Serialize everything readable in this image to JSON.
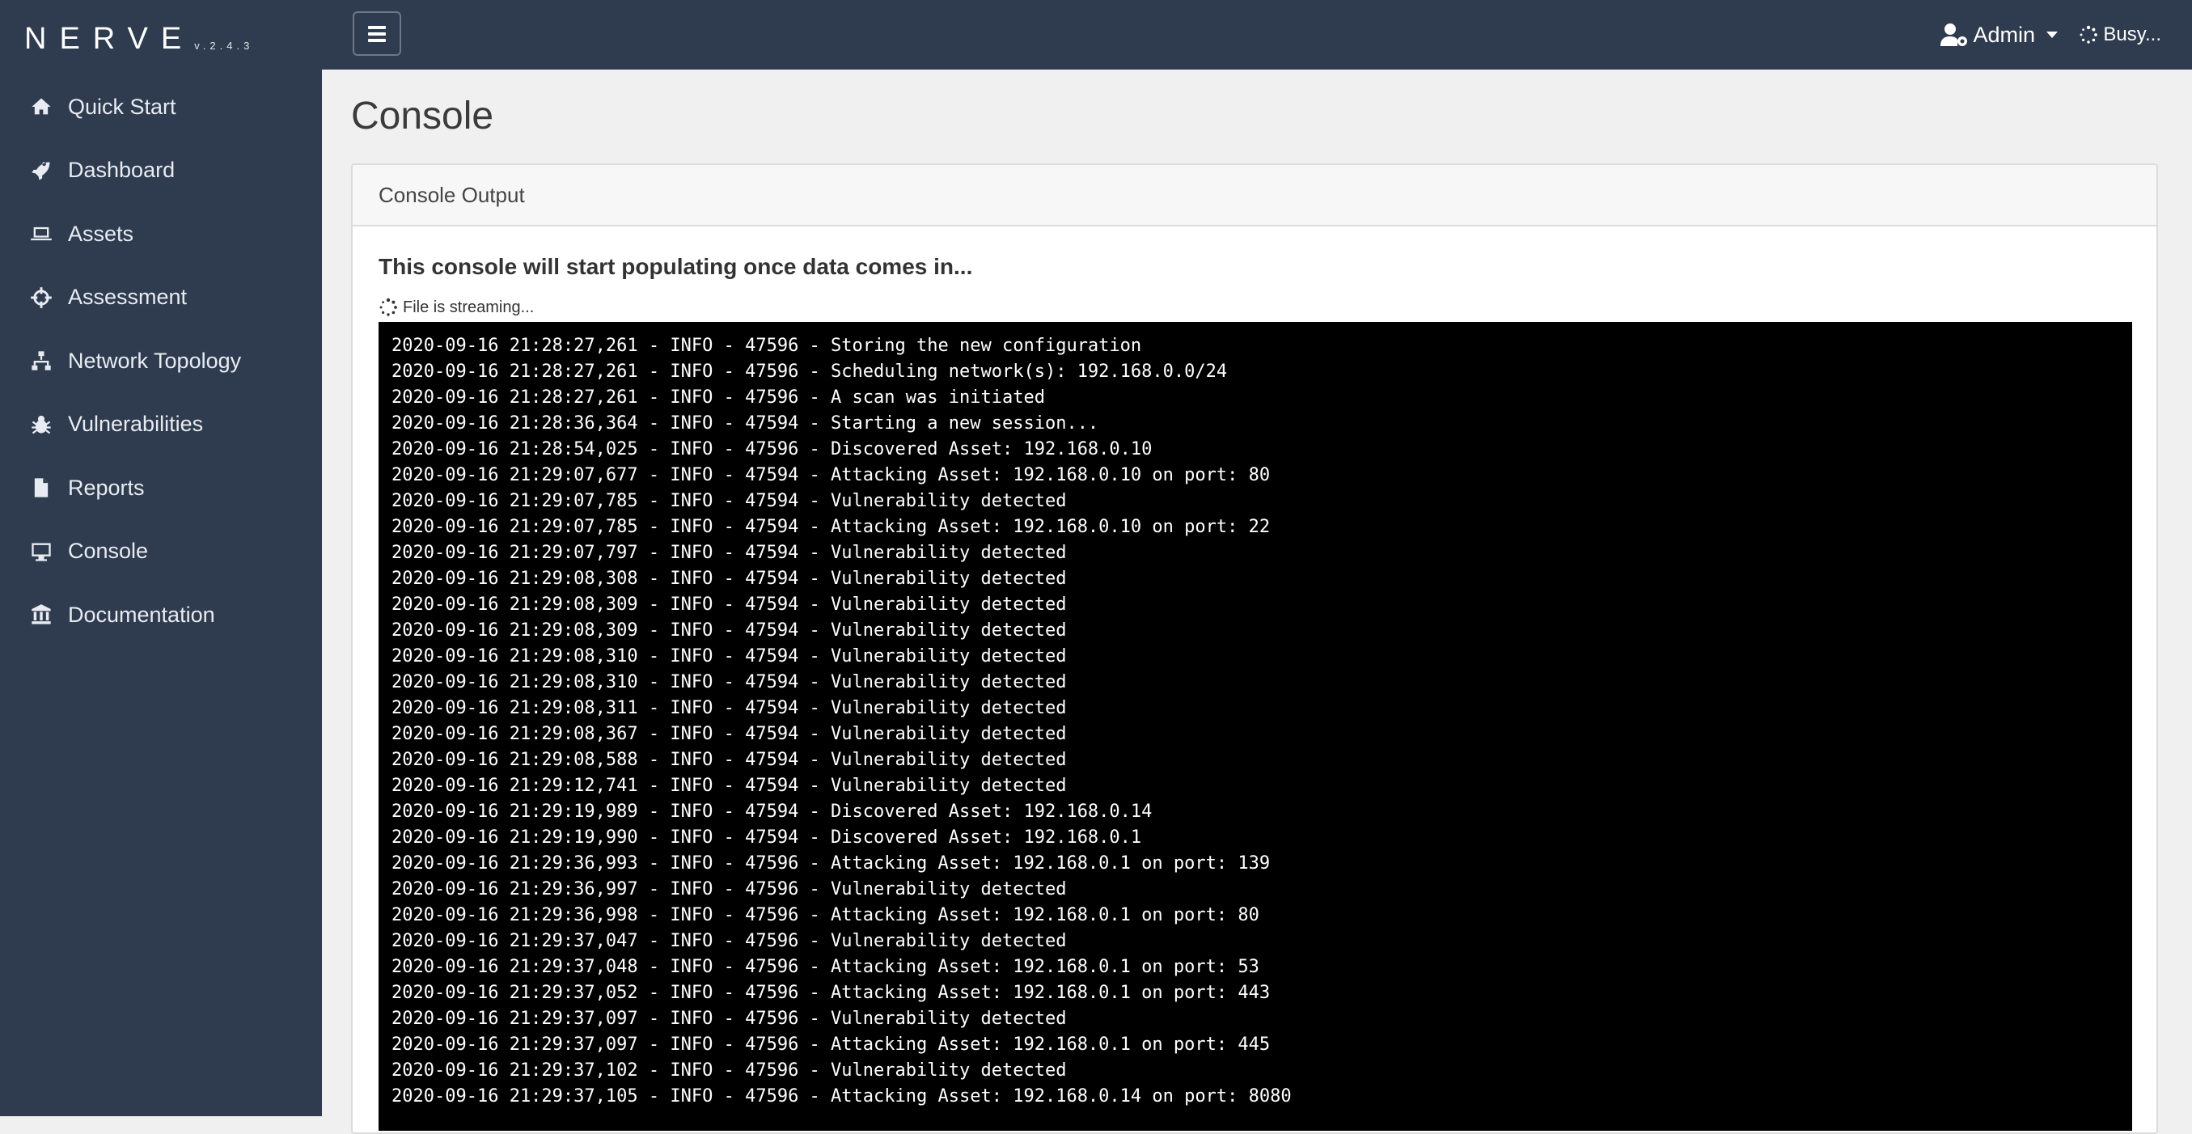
{
  "brand": {
    "name": "NERVE",
    "version": "v.2.4.3"
  },
  "sidebar": {
    "items": [
      {
        "label": "Quick Start",
        "icon": "home-icon"
      },
      {
        "label": "Dashboard",
        "icon": "rocket-icon"
      },
      {
        "label": "Assets",
        "icon": "laptop-icon"
      },
      {
        "label": "Assessment",
        "icon": "crosshairs-icon"
      },
      {
        "label": "Network Topology",
        "icon": "sitemap-icon"
      },
      {
        "label": "Vulnerabilities",
        "icon": "bug-icon"
      },
      {
        "label": "Reports",
        "icon": "file-icon"
      },
      {
        "label": "Console",
        "icon": "desktop-icon"
      },
      {
        "label": "Documentation",
        "icon": "university-icon"
      }
    ]
  },
  "topbar": {
    "user_label": "Admin",
    "status_label": "Busy..."
  },
  "main": {
    "title": "Console",
    "card_header": "Console Output",
    "lead": "This console will start populating once data comes in...",
    "streaming_label": "File is streaming...",
    "log_lines": [
      "2020-09-16 21:28:27,261 - INFO - 47596 - Storing the new configuration",
      "2020-09-16 21:28:27,261 - INFO - 47596 - Scheduling network(s): 192.168.0.0/24",
      "2020-09-16 21:28:27,261 - INFO - 47596 - A scan was initiated",
      "2020-09-16 21:28:36,364 - INFO - 47594 - Starting a new session...",
      "2020-09-16 21:28:54,025 - INFO - 47596 - Discovered Asset: 192.168.0.10",
      "2020-09-16 21:29:07,677 - INFO - 47594 - Attacking Asset: 192.168.0.10 on port: 80",
      "2020-09-16 21:29:07,785 - INFO - 47594 - Vulnerability detected",
      "2020-09-16 21:29:07,785 - INFO - 47594 - Attacking Asset: 192.168.0.10 on port: 22",
      "2020-09-16 21:29:07,797 - INFO - 47594 - Vulnerability detected",
      "2020-09-16 21:29:08,308 - INFO - 47594 - Vulnerability detected",
      "2020-09-16 21:29:08,309 - INFO - 47594 - Vulnerability detected",
      "2020-09-16 21:29:08,309 - INFO - 47594 - Vulnerability detected",
      "2020-09-16 21:29:08,310 - INFO - 47594 - Vulnerability detected",
      "2020-09-16 21:29:08,310 - INFO - 47594 - Vulnerability detected",
      "2020-09-16 21:29:08,311 - INFO - 47594 - Vulnerability detected",
      "2020-09-16 21:29:08,367 - INFO - 47594 - Vulnerability detected",
      "2020-09-16 21:29:08,588 - INFO - 47594 - Vulnerability detected",
      "2020-09-16 21:29:12,741 - INFO - 47594 - Vulnerability detected",
      "2020-09-16 21:29:19,989 - INFO - 47594 - Discovered Asset: 192.168.0.14",
      "2020-09-16 21:29:19,990 - INFO - 47594 - Discovered Asset: 192.168.0.1",
      "2020-09-16 21:29:36,993 - INFO - 47596 - Attacking Asset: 192.168.0.1 on port: 139",
      "2020-09-16 21:29:36,997 - INFO - 47596 - Vulnerability detected",
      "2020-09-16 21:29:36,998 - INFO - 47596 - Attacking Asset: 192.168.0.1 on port: 80",
      "2020-09-16 21:29:37,047 - INFO - 47596 - Vulnerability detected",
      "2020-09-16 21:29:37,048 - INFO - 47596 - Attacking Asset: 192.168.0.1 on port: 53",
      "2020-09-16 21:29:37,052 - INFO - 47596 - Attacking Asset: 192.168.0.1 on port: 443",
      "2020-09-16 21:29:37,097 - INFO - 47596 - Vulnerability detected",
      "2020-09-16 21:29:37,097 - INFO - 47596 - Attacking Asset: 192.168.0.1 on port: 445",
      "2020-09-16 21:29:37,102 - INFO - 47596 - Vulnerability detected",
      "2020-09-16 21:29:37,105 - INFO - 47596 - Attacking Asset: 192.168.0.14 on port: 8080"
    ]
  },
  "colors": {
    "sidebar_bg": "#2f3b4e",
    "main_bg": "#f0f0f0",
    "console_bg": "#000000",
    "console_text": "#ffffff"
  }
}
